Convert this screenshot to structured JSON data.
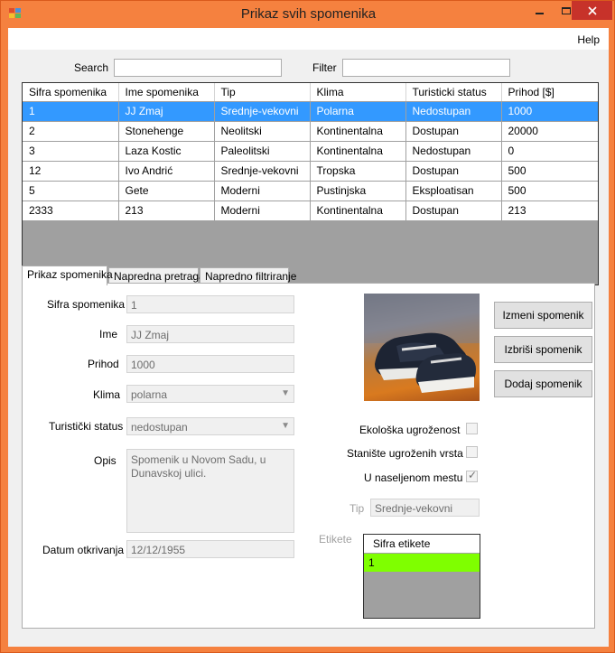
{
  "window": {
    "title": "Prikaz svih spomenika"
  },
  "menu": {
    "help": "Help"
  },
  "search": {
    "label": "Search",
    "value": ""
  },
  "filter": {
    "label": "Filter",
    "value": ""
  },
  "grid": {
    "columns": [
      "Sifra spomenika",
      "Ime spomenika",
      "Tip",
      "Klima",
      "Turisticki status",
      "Prihod [$]"
    ],
    "rows": [
      [
        "1",
        "JJ Zmaj",
        "Srednje-vekovni",
        "Polarna",
        "Nedostupan",
        "1000"
      ],
      [
        "2",
        "Stonehenge",
        "Neolitski",
        "Kontinentalna",
        "Dostupan",
        "20000"
      ],
      [
        "3",
        "Laza Kostic",
        "Paleolitski",
        "Kontinentalna",
        "Nedostupan",
        "0"
      ],
      [
        "12",
        "Ivo Andrić",
        "Srednje-vekovni",
        "Tropska",
        "Dostupan",
        "500"
      ],
      [
        "5",
        "Gete",
        "Moderni",
        "Pustinjska",
        "Eksploatisan",
        "500"
      ],
      [
        "2333",
        "213",
        "Moderni",
        "Kontinentalna",
        "Dostupan",
        "213"
      ]
    ],
    "selected_row": 0
  },
  "tabs": [
    "Prikaz spomenika",
    "Napredna pretraga",
    "Napredno filtriranje"
  ],
  "details": {
    "sifra_label": "Sifra spomenika",
    "sifra_value": "1",
    "ime_label": "Ime",
    "ime_value": "JJ Zmaj",
    "prihod_label": "Prihod",
    "prihod_value": "1000",
    "klima_label": "Klima",
    "klima_value": "polarna",
    "status_label": "Turistički status",
    "status_value": "nedostupan",
    "opis_label": "Opis",
    "opis_value": "Spomenik u Novom Sadu, u\nDunavskoj ulici.",
    "datum_label": "Datum otkrivanja",
    "datum_value": "12/12/1955"
  },
  "buttons": {
    "izmeni": "Izmeni spomenik",
    "izbrisi": "Izbriši spomenik",
    "dodaj": "Dodaj spomenik"
  },
  "checks": {
    "ekoloska": {
      "label": "Ekološka ugroženost",
      "checked": false
    },
    "staniste": {
      "label": "Stanište ugroženih vrsta",
      "checked": false
    },
    "naseljeno": {
      "label": "U naseljenom mestu",
      "checked": true
    }
  },
  "tip": {
    "label": "Tip",
    "value": "Srednje-vekovni"
  },
  "etikete": {
    "label": "Etikete",
    "column": "Sifra etikete",
    "rows": [
      "1"
    ]
  },
  "colors": {
    "selection": "#3399ff",
    "etiketa_row": "#7fff00",
    "frame": "#f5813f"
  },
  "icons": [
    "app-icon",
    "minimize-icon",
    "maximize-icon",
    "close-icon",
    "chevron-down-icon",
    "checkmark-icon",
    "shoe-photo"
  ]
}
